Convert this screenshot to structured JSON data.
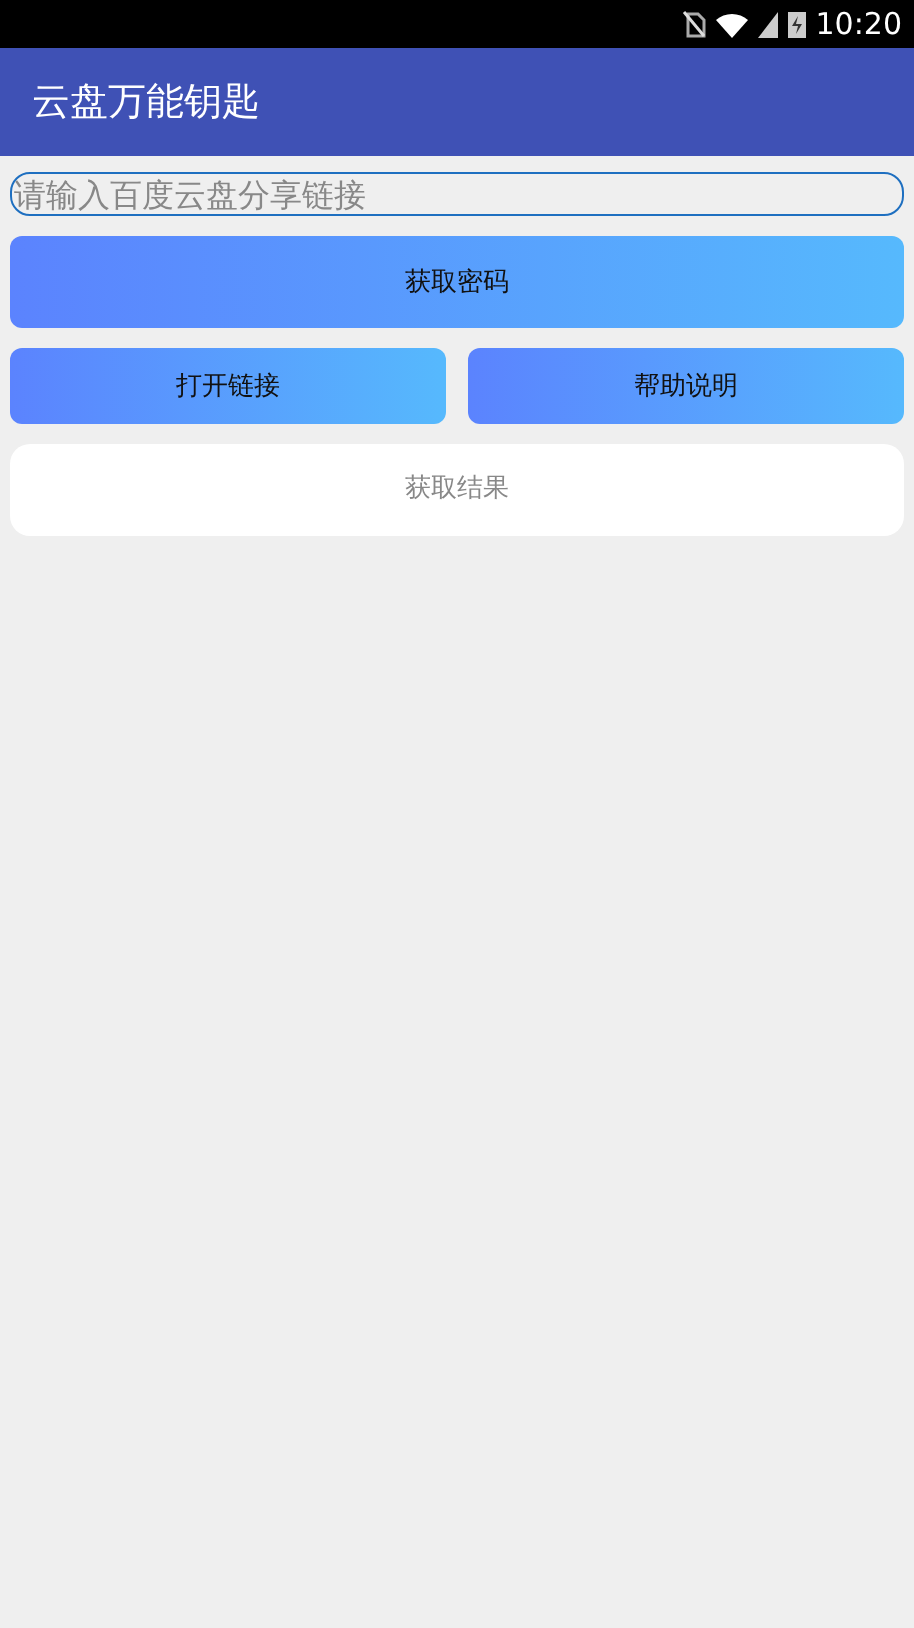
{
  "status_bar": {
    "time": "10:20"
  },
  "app_bar": {
    "title": "云盘万能钥匙"
  },
  "link_field": {
    "placeholder": "请输入百度云盘分享链接"
  },
  "get_password_button": "获取密码",
  "buttons": [
    "打开链接",
    "帮助说明"
  ],
  "result_panel": {
    "placeholder": "获取结果"
  }
}
